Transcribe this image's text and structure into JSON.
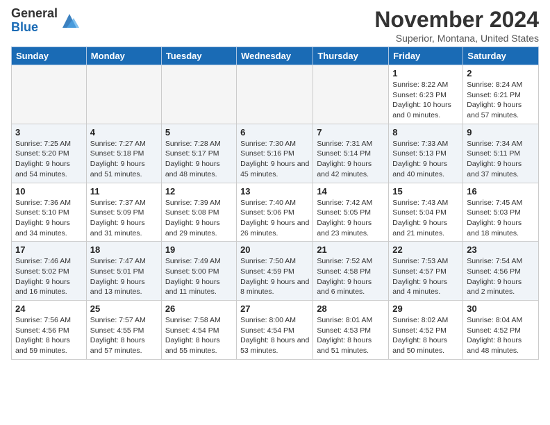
{
  "header": {
    "logo_general": "General",
    "logo_blue": "Blue",
    "month_title": "November 2024",
    "location": "Superior, Montana, United States"
  },
  "days_of_week": [
    "Sunday",
    "Monday",
    "Tuesday",
    "Wednesday",
    "Thursday",
    "Friday",
    "Saturday"
  ],
  "weeks": [
    [
      {
        "day": "",
        "empty": true
      },
      {
        "day": "",
        "empty": true
      },
      {
        "day": "",
        "empty": true
      },
      {
        "day": "",
        "empty": true
      },
      {
        "day": "",
        "empty": true
      },
      {
        "day": "1",
        "sunrise": "Sunrise: 8:22 AM",
        "sunset": "Sunset: 6:23 PM",
        "daylight": "Daylight: 10 hours and 0 minutes."
      },
      {
        "day": "2",
        "sunrise": "Sunrise: 8:24 AM",
        "sunset": "Sunset: 6:21 PM",
        "daylight": "Daylight: 9 hours and 57 minutes."
      }
    ],
    [
      {
        "day": "3",
        "sunrise": "Sunrise: 7:25 AM",
        "sunset": "Sunset: 5:20 PM",
        "daylight": "Daylight: 9 hours and 54 minutes."
      },
      {
        "day": "4",
        "sunrise": "Sunrise: 7:27 AM",
        "sunset": "Sunset: 5:18 PM",
        "daylight": "Daylight: 9 hours and 51 minutes."
      },
      {
        "day": "5",
        "sunrise": "Sunrise: 7:28 AM",
        "sunset": "Sunset: 5:17 PM",
        "daylight": "Daylight: 9 hours and 48 minutes."
      },
      {
        "day": "6",
        "sunrise": "Sunrise: 7:30 AM",
        "sunset": "Sunset: 5:16 PM",
        "daylight": "Daylight: 9 hours and 45 minutes."
      },
      {
        "day": "7",
        "sunrise": "Sunrise: 7:31 AM",
        "sunset": "Sunset: 5:14 PM",
        "daylight": "Daylight: 9 hours and 42 minutes."
      },
      {
        "day": "8",
        "sunrise": "Sunrise: 7:33 AM",
        "sunset": "Sunset: 5:13 PM",
        "daylight": "Daylight: 9 hours and 40 minutes."
      },
      {
        "day": "9",
        "sunrise": "Sunrise: 7:34 AM",
        "sunset": "Sunset: 5:11 PM",
        "daylight": "Daylight: 9 hours and 37 minutes."
      }
    ],
    [
      {
        "day": "10",
        "sunrise": "Sunrise: 7:36 AM",
        "sunset": "Sunset: 5:10 PM",
        "daylight": "Daylight: 9 hours and 34 minutes."
      },
      {
        "day": "11",
        "sunrise": "Sunrise: 7:37 AM",
        "sunset": "Sunset: 5:09 PM",
        "daylight": "Daylight: 9 hours and 31 minutes."
      },
      {
        "day": "12",
        "sunrise": "Sunrise: 7:39 AM",
        "sunset": "Sunset: 5:08 PM",
        "daylight": "Daylight: 9 hours and 29 minutes."
      },
      {
        "day": "13",
        "sunrise": "Sunrise: 7:40 AM",
        "sunset": "Sunset: 5:06 PM",
        "daylight": "Daylight: 9 hours and 26 minutes."
      },
      {
        "day": "14",
        "sunrise": "Sunrise: 7:42 AM",
        "sunset": "Sunset: 5:05 PM",
        "daylight": "Daylight: 9 hours and 23 minutes."
      },
      {
        "day": "15",
        "sunrise": "Sunrise: 7:43 AM",
        "sunset": "Sunset: 5:04 PM",
        "daylight": "Daylight: 9 hours and 21 minutes."
      },
      {
        "day": "16",
        "sunrise": "Sunrise: 7:45 AM",
        "sunset": "Sunset: 5:03 PM",
        "daylight": "Daylight: 9 hours and 18 minutes."
      }
    ],
    [
      {
        "day": "17",
        "sunrise": "Sunrise: 7:46 AM",
        "sunset": "Sunset: 5:02 PM",
        "daylight": "Daylight: 9 hours and 16 minutes."
      },
      {
        "day": "18",
        "sunrise": "Sunrise: 7:47 AM",
        "sunset": "Sunset: 5:01 PM",
        "daylight": "Daylight: 9 hours and 13 minutes."
      },
      {
        "day": "19",
        "sunrise": "Sunrise: 7:49 AM",
        "sunset": "Sunset: 5:00 PM",
        "daylight": "Daylight: 9 hours and 11 minutes."
      },
      {
        "day": "20",
        "sunrise": "Sunrise: 7:50 AM",
        "sunset": "Sunset: 4:59 PM",
        "daylight": "Daylight: 9 hours and 8 minutes."
      },
      {
        "day": "21",
        "sunrise": "Sunrise: 7:52 AM",
        "sunset": "Sunset: 4:58 PM",
        "daylight": "Daylight: 9 hours and 6 minutes."
      },
      {
        "day": "22",
        "sunrise": "Sunrise: 7:53 AM",
        "sunset": "Sunset: 4:57 PM",
        "daylight": "Daylight: 9 hours and 4 minutes."
      },
      {
        "day": "23",
        "sunrise": "Sunrise: 7:54 AM",
        "sunset": "Sunset: 4:56 PM",
        "daylight": "Daylight: 9 hours and 2 minutes."
      }
    ],
    [
      {
        "day": "24",
        "sunrise": "Sunrise: 7:56 AM",
        "sunset": "Sunset: 4:56 PM",
        "daylight": "Daylight: 8 hours and 59 minutes."
      },
      {
        "day": "25",
        "sunrise": "Sunrise: 7:57 AM",
        "sunset": "Sunset: 4:55 PM",
        "daylight": "Daylight: 8 hours and 57 minutes."
      },
      {
        "day": "26",
        "sunrise": "Sunrise: 7:58 AM",
        "sunset": "Sunset: 4:54 PM",
        "daylight": "Daylight: 8 hours and 55 minutes."
      },
      {
        "day": "27",
        "sunrise": "Sunrise: 8:00 AM",
        "sunset": "Sunset: 4:54 PM",
        "daylight": "Daylight: 8 hours and 53 minutes."
      },
      {
        "day": "28",
        "sunrise": "Sunrise: 8:01 AM",
        "sunset": "Sunset: 4:53 PM",
        "daylight": "Daylight: 8 hours and 51 minutes."
      },
      {
        "day": "29",
        "sunrise": "Sunrise: 8:02 AM",
        "sunset": "Sunset: 4:52 PM",
        "daylight": "Daylight: 8 hours and 50 minutes."
      },
      {
        "day": "30",
        "sunrise": "Sunrise: 8:04 AM",
        "sunset": "Sunset: 4:52 PM",
        "daylight": "Daylight: 8 hours and 48 minutes."
      }
    ]
  ]
}
